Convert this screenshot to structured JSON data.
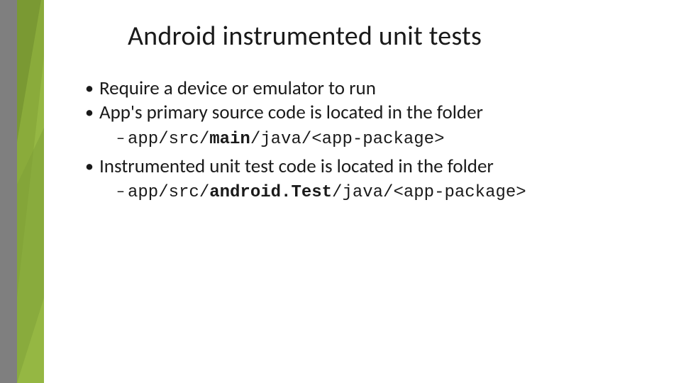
{
  "title": "Android instrumented unit tests",
  "bullets": {
    "b1": "Require a device or emulator to run",
    "b2": "App's primary source code is located in the folder",
    "b2_sub_pre": "app/src/",
    "b2_sub_bold": "main",
    "b2_sub_post": "/java/<app-package>",
    "b3": "Instrumented unit test code is located in the folder",
    "b3_sub_pre": "app/src/",
    "b3_sub_bold": "android.Test",
    "b3_sub_post": "/java/<app-package>"
  },
  "colors": {
    "accent_green": "#8aab3b",
    "accent_gray": "#7f7f7f"
  }
}
